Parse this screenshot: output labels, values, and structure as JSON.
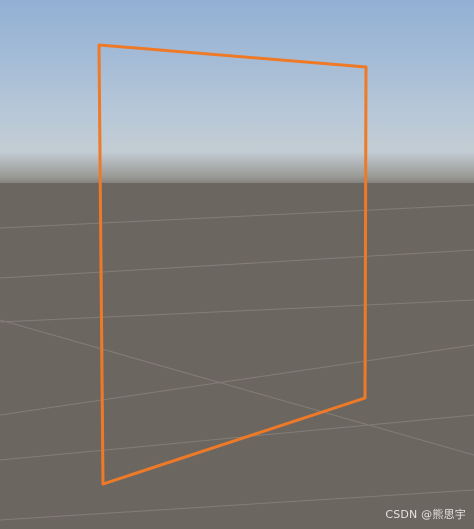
{
  "viewport": {
    "name": "scene-view",
    "sky_color_top": "#93b0d4",
    "horizon_color": "#c3ccd3",
    "ground_color": "#6c6661",
    "grid_color": "#837d78"
  },
  "selection": {
    "name": "selected-quad-outline",
    "outline_color": "#ee7a28"
  },
  "watermark": {
    "text": "CSDN @熊思宇"
  }
}
